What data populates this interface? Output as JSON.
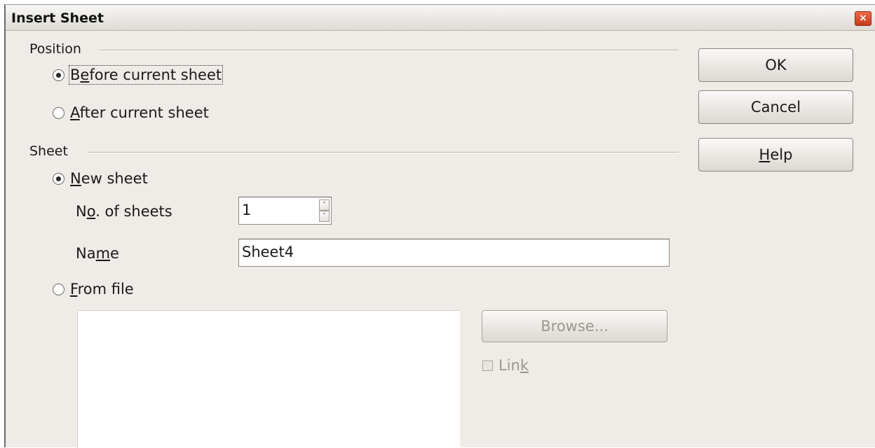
{
  "window": {
    "title": "Insert Sheet",
    "close_symbol": "×"
  },
  "position": {
    "label": "Position",
    "options": [
      {
        "label_pre": "B",
        "label_mn": "e",
        "label_post": "fore current sheet",
        "checked": true
      },
      {
        "label_pre": "",
        "label_mn": "A",
        "label_post": "fter current sheet",
        "checked": false
      }
    ]
  },
  "sheet": {
    "label": "Sheet",
    "new_sheet": {
      "label_pre": "",
      "label_mn": "N",
      "label_post": "ew sheet",
      "checked": true
    },
    "count": {
      "label_pre": "N",
      "label_mn": "o",
      "label_post": ". of sheets",
      "value": "1",
      "up_symbol": "˄",
      "down_symbol": "˅"
    },
    "name": {
      "label_pre": "Na",
      "label_mn": "m",
      "label_post": "e",
      "value": "Sheet4"
    },
    "from_file": {
      "label_pre": "",
      "label_mn": "F",
      "label_post": "rom file",
      "checked": false
    },
    "browse_label": "Browse...",
    "link": {
      "label_pre": "Lin",
      "label_mn": "k",
      "label_post": "",
      "checked": false
    }
  },
  "buttons": {
    "ok": "OK",
    "cancel": "Cancel",
    "help_pre": "",
    "help_mn": "H",
    "help_post": "elp"
  }
}
